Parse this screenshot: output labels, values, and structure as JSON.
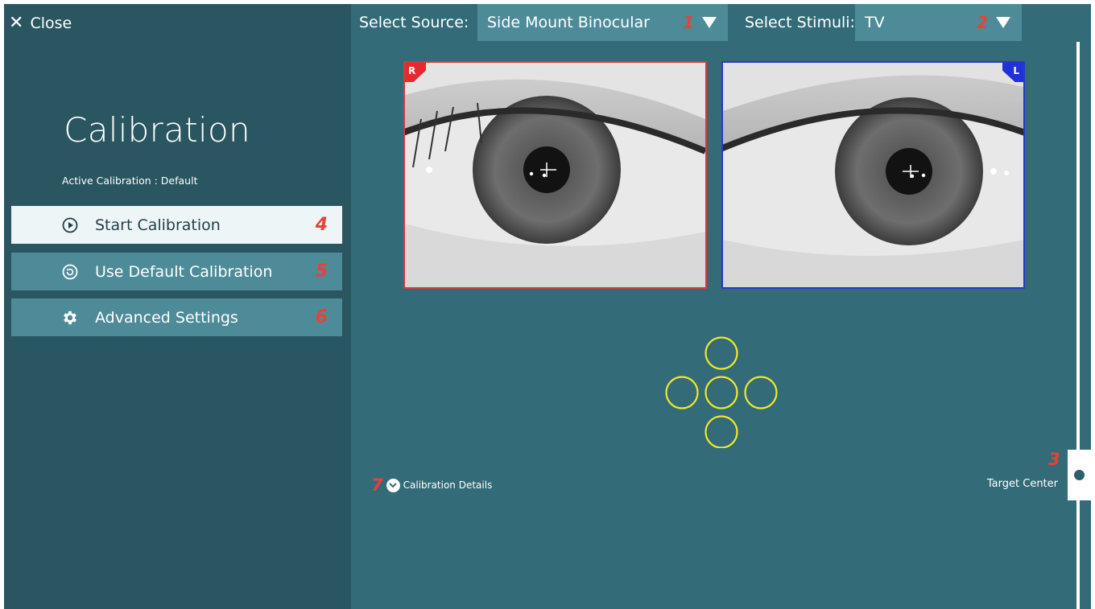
{
  "header": {
    "close_label": "Close",
    "source_label": "Select Source:",
    "source_value": "Side Mount Binocular",
    "source_marker": "1",
    "stimuli_label": "Select Stimuli:",
    "stimuli_value": "TV",
    "stimuli_marker": "2"
  },
  "sidebar": {
    "title": "Calibration",
    "active_calibration": "Active Calibration : Default",
    "buttons": [
      {
        "label": "Start Calibration",
        "icon": "play-circle-icon",
        "marker": "4"
      },
      {
        "label": "Use Default Calibration",
        "icon": "reset-circle-icon",
        "marker": "5"
      },
      {
        "label": "Advanced Settings",
        "icon": "gear-icon",
        "marker": "6"
      }
    ]
  },
  "eyes": {
    "right_tag": "R",
    "left_tag": "L",
    "right_border_color": "#d8383a",
    "left_border_color": "#2b36d0"
  },
  "targets": {
    "color": "#f0e82a",
    "layout": "cross-5"
  },
  "details": {
    "label": "Calibration Details",
    "marker": "7"
  },
  "slider": {
    "label": "Target Center",
    "marker": "3"
  },
  "colors": {
    "main_bg": "#336b78",
    "sidebar_bg": "#295661",
    "button_bg": "#4d8b98",
    "marker": "#e8413a"
  }
}
